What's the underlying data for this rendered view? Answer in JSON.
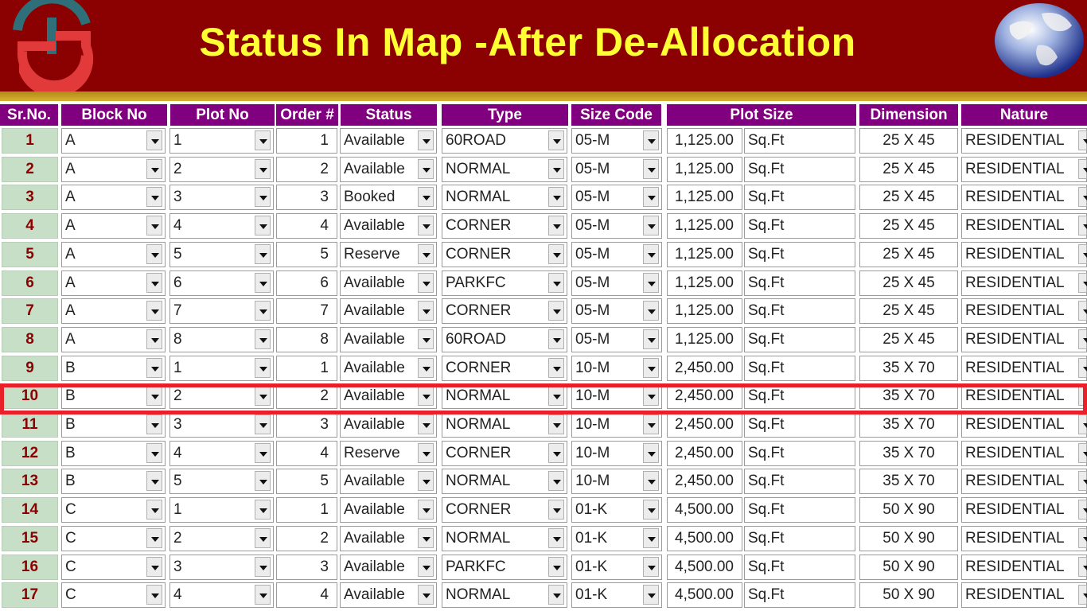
{
  "banner": {
    "title": "Status In Map -After De-Allocation"
  },
  "colors": {
    "banner_bg": "#8b0000",
    "title_text": "#ffff33",
    "header_bg": "#800080",
    "sr_cell_bg": "#c7dfc7",
    "highlight_border": "#e8202a"
  },
  "table": {
    "headers": [
      "Sr.No.",
      "Block No",
      "Plot No",
      "Order #",
      "Status",
      "Type",
      "Size Code",
      "Plot Size",
      "Dimension",
      "Nature"
    ],
    "highlighted_sr": "10",
    "rows": [
      {
        "sr": "1",
        "block": "A",
        "plot": "1",
        "order": "1",
        "status": "Available",
        "type": "60ROAD",
        "size_code": "05-M",
        "plot_size": "1,125.00",
        "unit": "Sq.Ft",
        "dimension": "25 X 45",
        "nature": "RESIDENTIAL"
      },
      {
        "sr": "2",
        "block": "A",
        "plot": "2",
        "order": "2",
        "status": "Available",
        "type": "NORMAL",
        "size_code": "05-M",
        "plot_size": "1,125.00",
        "unit": "Sq.Ft",
        "dimension": "25 X 45",
        "nature": "RESIDENTIAL"
      },
      {
        "sr": "3",
        "block": "A",
        "plot": "3",
        "order": "3",
        "status": "Booked",
        "type": "NORMAL",
        "size_code": "05-M",
        "plot_size": "1,125.00",
        "unit": "Sq.Ft",
        "dimension": "25 X 45",
        "nature": "RESIDENTIAL"
      },
      {
        "sr": "4",
        "block": "A",
        "plot": "4",
        "order": "4",
        "status": "Available",
        "type": "CORNER",
        "size_code": "05-M",
        "plot_size": "1,125.00",
        "unit": "Sq.Ft",
        "dimension": "25 X 45",
        "nature": "RESIDENTIAL"
      },
      {
        "sr": "5",
        "block": "A",
        "plot": "5",
        "order": "5",
        "status": "Reserve",
        "type": "CORNER",
        "size_code": "05-M",
        "plot_size": "1,125.00",
        "unit": "Sq.Ft",
        "dimension": "25 X 45",
        "nature": "RESIDENTIAL"
      },
      {
        "sr": "6",
        "block": "A",
        "plot": "6",
        "order": "6",
        "status": "Available",
        "type": "PARKFC",
        "size_code": "05-M",
        "plot_size": "1,125.00",
        "unit": "Sq.Ft",
        "dimension": "25 X 45",
        "nature": "RESIDENTIAL"
      },
      {
        "sr": "7",
        "block": "A",
        "plot": "7",
        "order": "7",
        "status": "Available",
        "type": "CORNER",
        "size_code": "05-M",
        "plot_size": "1,125.00",
        "unit": "Sq.Ft",
        "dimension": "25 X 45",
        "nature": "RESIDENTIAL"
      },
      {
        "sr": "8",
        "block": "A",
        "plot": "8",
        "order": "8",
        "status": "Available",
        "type": "60ROAD",
        "size_code": "05-M",
        "plot_size": "1,125.00",
        "unit": "Sq.Ft",
        "dimension": "25 X 45",
        "nature": "RESIDENTIAL"
      },
      {
        "sr": "9",
        "block": "B",
        "plot": "1",
        "order": "1",
        "status": "Available",
        "type": "CORNER",
        "size_code": "10-M",
        "plot_size": "2,450.00",
        "unit": "Sq.Ft",
        "dimension": "35 X 70",
        "nature": "RESIDENTIAL"
      },
      {
        "sr": "10",
        "block": "B",
        "plot": "2",
        "order": "2",
        "status": "Available",
        "type": "NORMAL",
        "size_code": "10-M",
        "plot_size": "2,450.00",
        "unit": "Sq.Ft",
        "dimension": "35 X 70",
        "nature": "RESIDENTIAL"
      },
      {
        "sr": "11",
        "block": "B",
        "plot": "3",
        "order": "3",
        "status": "Available",
        "type": "NORMAL",
        "size_code": "10-M",
        "plot_size": "2,450.00",
        "unit": "Sq.Ft",
        "dimension": "35 X 70",
        "nature": "RESIDENTIAL"
      },
      {
        "sr": "12",
        "block": "B",
        "plot": "4",
        "order": "4",
        "status": "Reserve",
        "type": "CORNER",
        "size_code": "10-M",
        "plot_size": "2,450.00",
        "unit": "Sq.Ft",
        "dimension": "35 X 70",
        "nature": "RESIDENTIAL"
      },
      {
        "sr": "13",
        "block": "B",
        "plot": "5",
        "order": "5",
        "status": "Available",
        "type": "NORMAL",
        "size_code": "10-M",
        "plot_size": "2,450.00",
        "unit": "Sq.Ft",
        "dimension": "35 X 70",
        "nature": "RESIDENTIAL"
      },
      {
        "sr": "14",
        "block": "C",
        "plot": "1",
        "order": "1",
        "status": "Available",
        "type": "CORNER",
        "size_code": "01-K",
        "plot_size": "4,500.00",
        "unit": "Sq.Ft",
        "dimension": "50 X 90",
        "nature": "RESIDENTIAL"
      },
      {
        "sr": "15",
        "block": "C",
        "plot": "2",
        "order": "2",
        "status": "Available",
        "type": "NORMAL",
        "size_code": "01-K",
        "plot_size": "4,500.00",
        "unit": "Sq.Ft",
        "dimension": "50 X 90",
        "nature": "RESIDENTIAL"
      },
      {
        "sr": "16",
        "block": "C",
        "plot": "3",
        "order": "3",
        "status": "Available",
        "type": "PARKFC",
        "size_code": "01-K",
        "plot_size": "4,500.00",
        "unit": "Sq.Ft",
        "dimension": "50 X 90",
        "nature": "RESIDENTIAL"
      },
      {
        "sr": "17",
        "block": "C",
        "plot": "4",
        "order": "4",
        "status": "Available",
        "type": "NORMAL",
        "size_code": "01-K",
        "plot_size": "4,500.00",
        "unit": "Sq.Ft",
        "dimension": "50 X 90",
        "nature": "RESIDENTIAL"
      }
    ]
  }
}
